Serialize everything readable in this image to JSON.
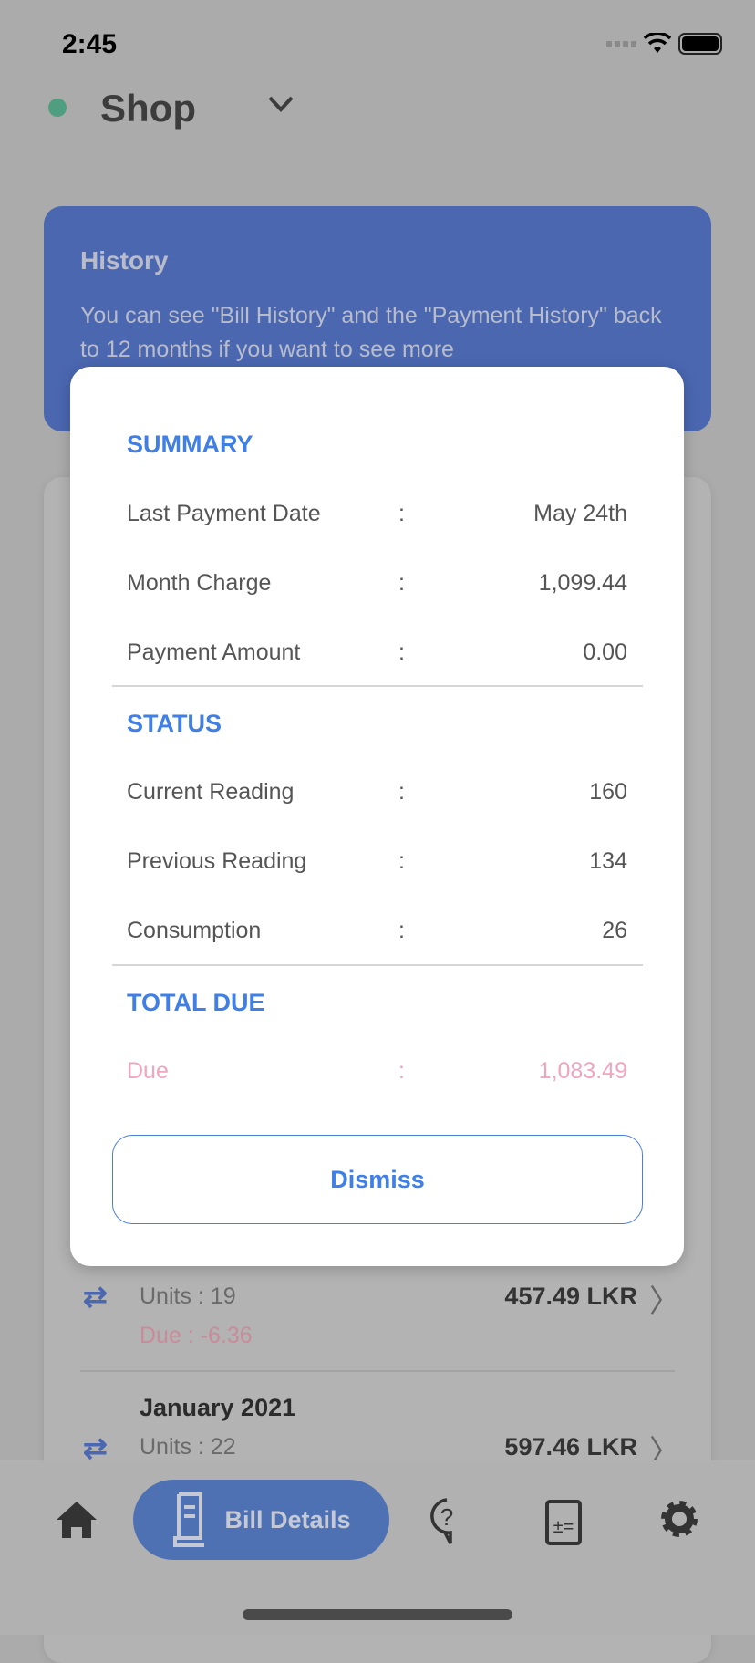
{
  "status_bar": {
    "time": "2:45"
  },
  "header": {
    "title": "Shop",
    "status_color": "#4e9e7f"
  },
  "info_card": {
    "title": "History",
    "text": "You can see \"Bill History\" and the \"Payment History\" back to 12 months if you want to see more"
  },
  "bill_list": [
    {
      "month": "",
      "units": "Units : 19",
      "due": "Due : -6.36",
      "amount": "457.49 LKR"
    },
    {
      "month": "January 2021",
      "units": "Units : 22",
      "due": "",
      "amount": "597.46 LKR"
    }
  ],
  "modal": {
    "summary_title": "SUMMARY",
    "summary": [
      {
        "label": "Last Payment Date",
        "sep": ":",
        "value": "May 24th"
      },
      {
        "label": "Month Charge",
        "sep": ":",
        "value": "1,099.44"
      },
      {
        "label": "Payment Amount",
        "sep": ":",
        "value": "0.00"
      }
    ],
    "status_title": "STATUS",
    "status": [
      {
        "label": "Current Reading",
        "sep": ":",
        "value": "160"
      },
      {
        "label": "Previous Reading",
        "sep": ":",
        "value": "134"
      },
      {
        "label": "Consumption",
        "sep": ":",
        "value": "26"
      }
    ],
    "total_title": "TOTAL DUE",
    "total": {
      "label": "Due",
      "sep": ":",
      "value": "1,083.49"
    },
    "dismiss_label": "Dismiss"
  },
  "bottom_nav": {
    "active_label": "Bill Details",
    "items": [
      "home-icon",
      "bill-details-icon",
      "help-icon",
      "calculator-icon",
      "settings-icon"
    ]
  },
  "colors": {
    "accent": "#3f7fe6",
    "due": "#f0a5bd"
  }
}
